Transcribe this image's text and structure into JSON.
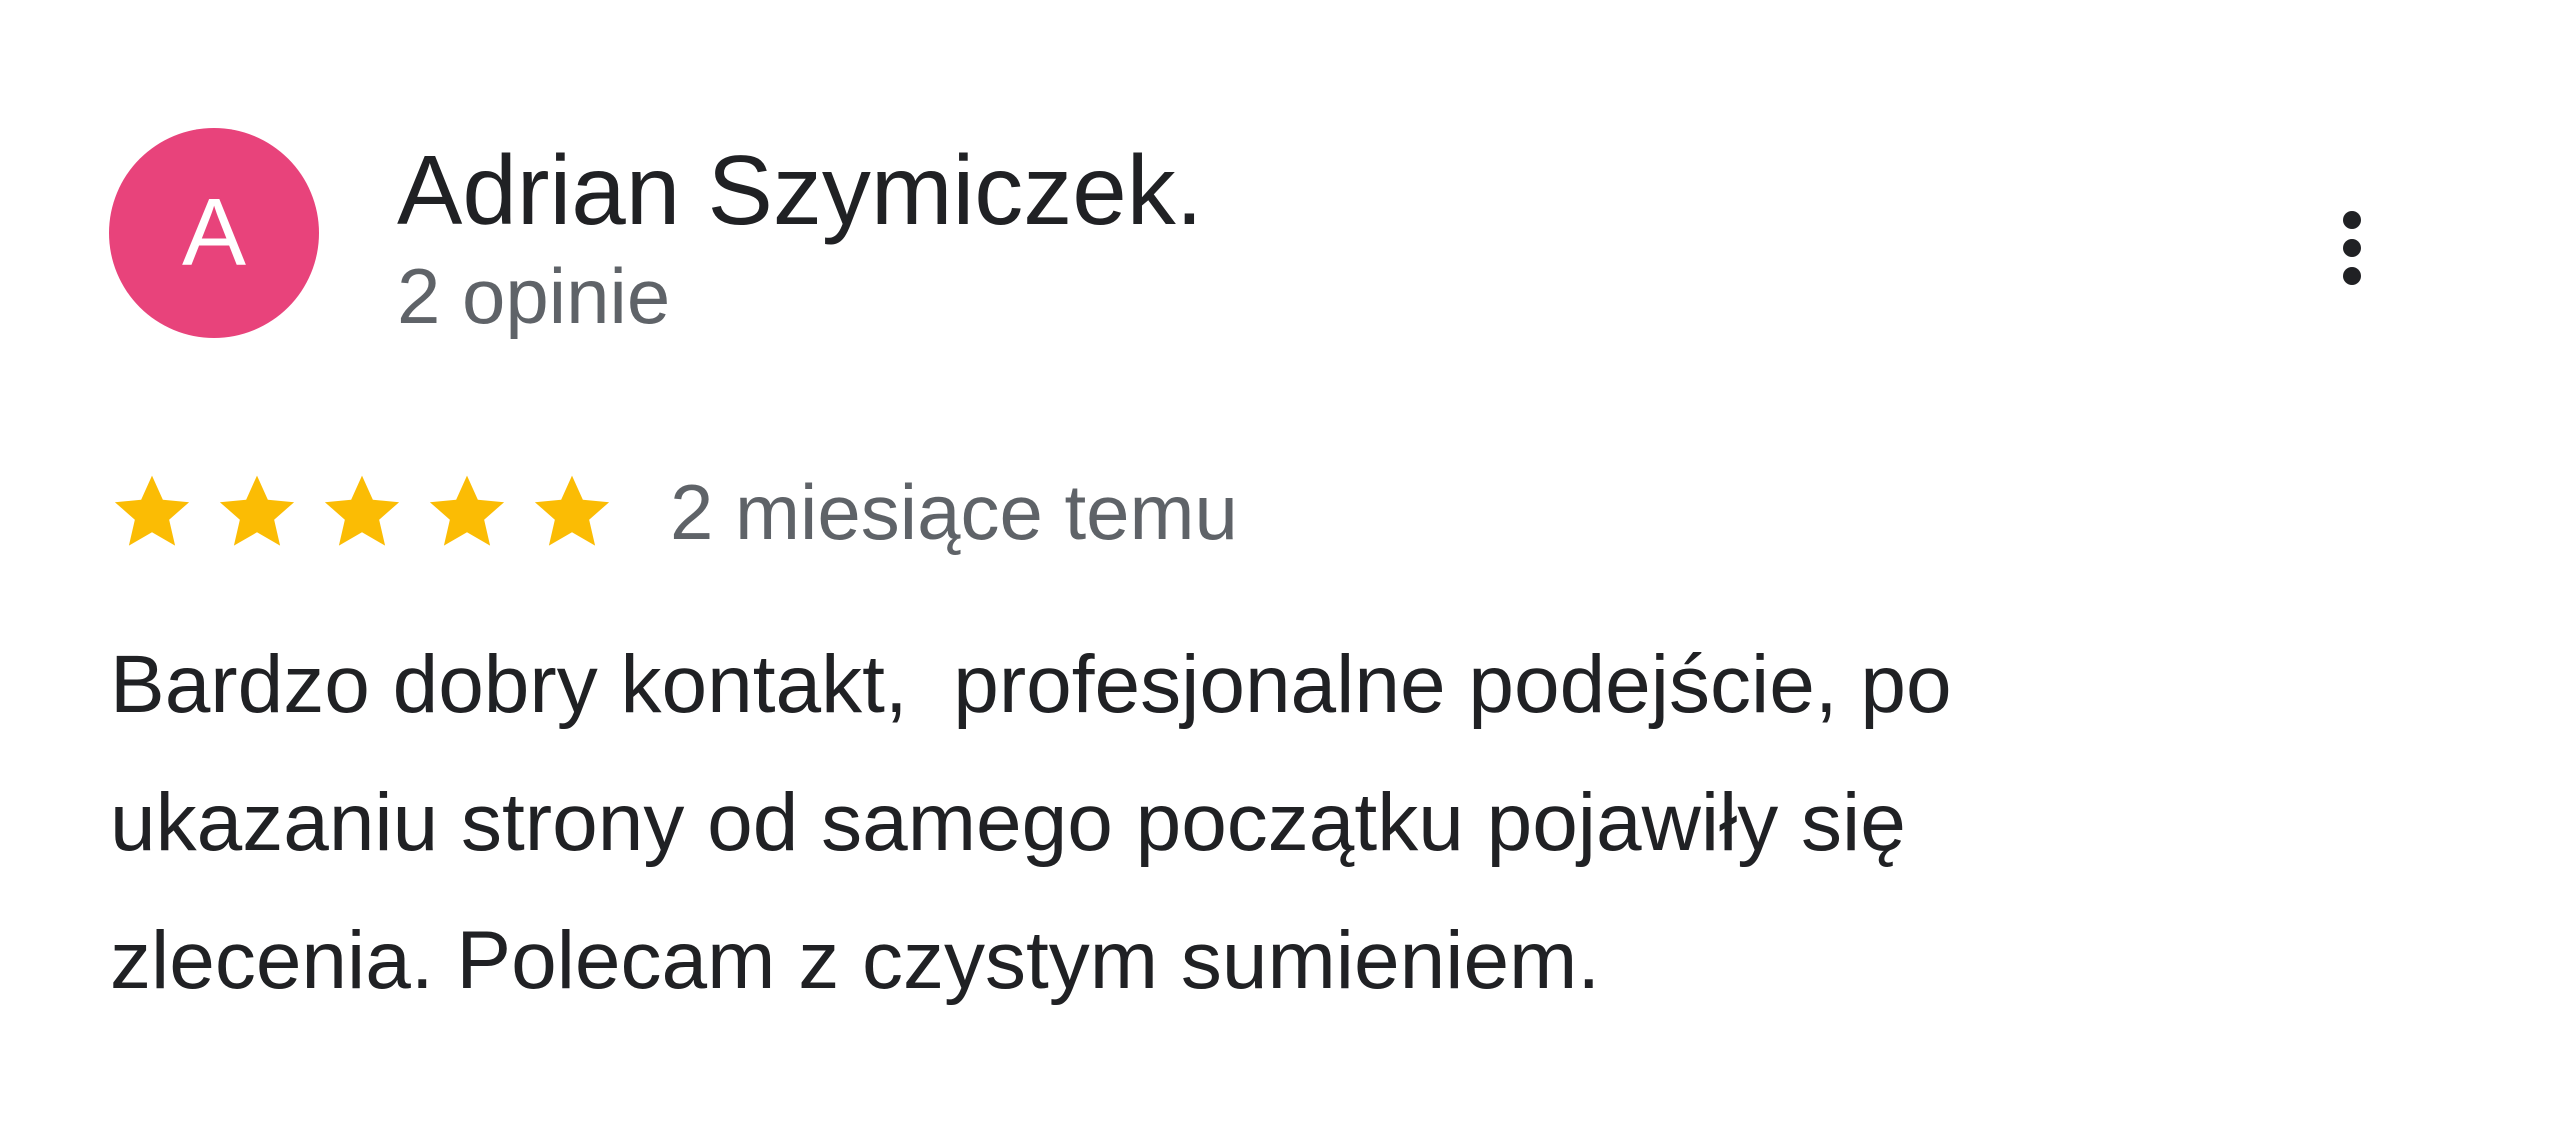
{
  "review": {
    "avatar_letter": "A",
    "avatar_color": "#e8437b",
    "author_name": "Adrian Szymiczek.",
    "author_meta": "2 opinie",
    "more_icon": "more-vert-icon",
    "rating": 5,
    "rating_max": 5,
    "star_color": "#fbbc04",
    "date": "2 miesiące temu",
    "text": "Bardzo dobry kontakt,  profesjonalne podejście, po\nukazaniu strony od samego początku pojawiły się\nzlecenia. Polecam z czystym sumieniem."
  }
}
